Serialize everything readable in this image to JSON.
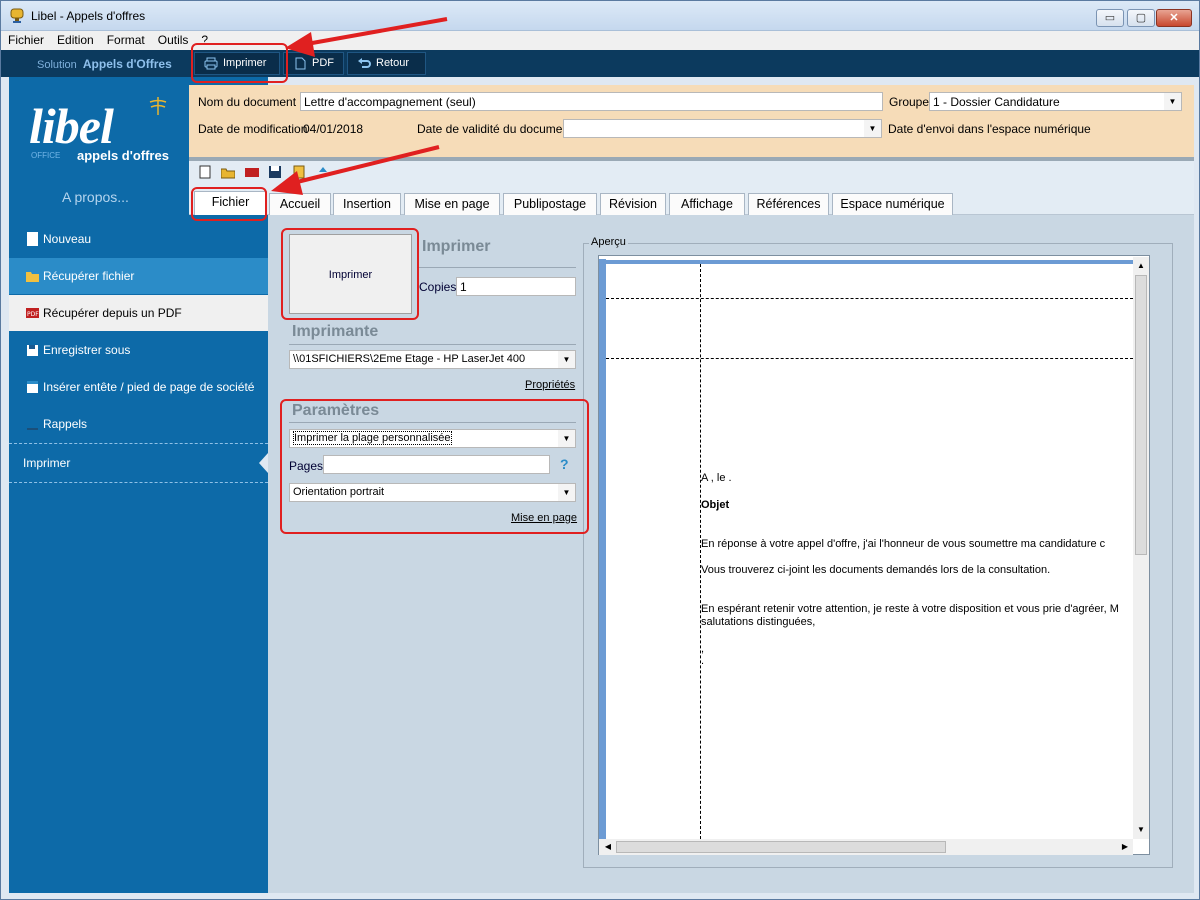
{
  "window": {
    "title": "Libel - Appels d'offres",
    "minimize": "▭",
    "maximize": "▢",
    "close": "✕"
  },
  "menu": [
    "Fichier",
    "Edition",
    "Format",
    "Outils",
    "?"
  ],
  "toolbar": {
    "solution_prefix": "Solution",
    "solution_name": "Appels d'Offres",
    "print_label": "Imprimer",
    "pdf_label": "PDF",
    "back_label": "Retour"
  },
  "sidebar": {
    "logo_text": "libel",
    "logo_office": "OFFICE",
    "logo_sub": "appels d'offres",
    "about": "A propos...",
    "items": [
      {
        "label": "Nouveau"
      },
      {
        "label": "Récupérer fichier"
      },
      {
        "label": "Récupérer depuis un PDF"
      },
      {
        "label": "Enregistrer sous"
      },
      {
        "label": "Insérer entête / pied de page de société"
      },
      {
        "label": "Rappels"
      },
      {
        "label": "Imprimer"
      }
    ]
  },
  "doc_header": {
    "name_label": "Nom du document",
    "name_value": "Lettre d'accompagnement (seul)",
    "group_label": "Groupe",
    "group_value": "1 - Dossier Candidature",
    "modified_label": "Date de modification",
    "modified_value": "04/01/2018",
    "validity_label": "Date de validité du document",
    "validity_value": "",
    "sent_label": "Date d'envoi dans l'espace numérique"
  },
  "tabs": [
    "Fichier",
    "Accueil",
    "Insertion",
    "Mise en page",
    "Publipostage",
    "Révision",
    "Affichage",
    "Références",
    "Espace numérique"
  ],
  "print": {
    "button_label": "Imprimer",
    "title": "Imprimer",
    "copies_label": "Copies",
    "copies_value": "1",
    "printer_title": "Imprimante",
    "printer_value": "\\\\01SFICHIERS\\2Eme Etage - HP LaserJet 400",
    "properties_link": "Propriétés",
    "params_title": "Paramètres",
    "range_value": "Imprimer la plage personnalisée",
    "pages_label": "Pages",
    "pages_value": "",
    "help_icon": "?",
    "orientation_value": "Orientation portrait",
    "layout_link": "Mise en page"
  },
  "preview": {
    "label": "Aperçu",
    "lines": [
      "A , le .",
      "Objet",
      "En réponse à votre appel d'offre, j'ai l'honneur de vous soumettre ma candidature c",
      "Vous trouverez ci-joint les documents demandés lors de la consultation.",
      "En espérant retenir votre attention, je reste à votre disposition et vous prie d'agréer, M",
      "salutations distinguées,",
      ",",
      "."
    ]
  },
  "colors": {
    "annotation": "#e02020",
    "sidebar": "#0d6aa8",
    "header": "#f6dcb8",
    "toolbar": "#0c3a5e"
  }
}
